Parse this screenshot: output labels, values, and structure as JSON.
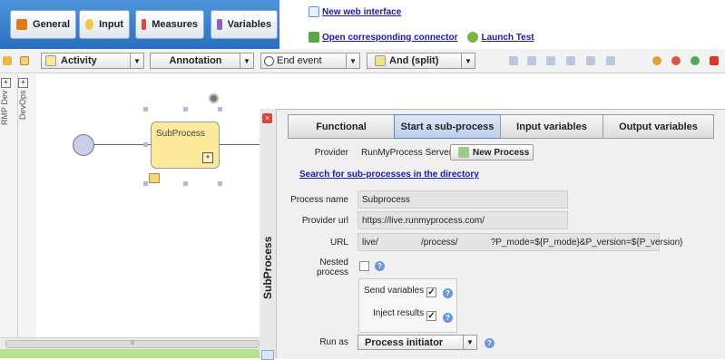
{
  "nav": {
    "general": "General",
    "input": "Input",
    "measures": "Measures",
    "variables": "Variables"
  },
  "links": {
    "new_interface": "New web interface",
    "open_connector": "Open corresponding connector",
    "launch_test": "Launch Test"
  },
  "toolbar": {
    "activity": "Activity",
    "annotation": "Annotation",
    "end_event": "End event",
    "and_split": "And (split)"
  },
  "left_strip": {
    "label_a": "RMP Dev",
    "label_b": "DevOps"
  },
  "canvas": {
    "subprocess_label": "SubProcess",
    "scroll_label": "III"
  },
  "panel": {
    "side_title": "SubProcess",
    "tabs": [
      "Functional",
      "Start a sub-process",
      "Input variables",
      "Output variables"
    ],
    "provider_label": "Provider",
    "provider_value": "RunMyProcess Server",
    "new_process_button": "New Process",
    "search_link": "Search for sub-processes in the directory",
    "process_name_label": "Process name",
    "process_name_value": "Subprocess",
    "provider_url_label": "Provider url",
    "provider_url_value": "https://live.runmyprocess.com/",
    "url_label": "URL",
    "url_value": "live/                 /process/             ?P_mode=${P_mode}&P_version=${P_version}",
    "nested_label": "Nested process",
    "send_variables_label": "Send variables",
    "inject_results_label": "Inject results",
    "run_as_label": "Run as",
    "run_as_value": "Process initiator"
  },
  "colors": {
    "nav_blue": "#2f78c6",
    "active_tab": "#bcd0ea",
    "subprocess_fill": "#fde99a"
  }
}
